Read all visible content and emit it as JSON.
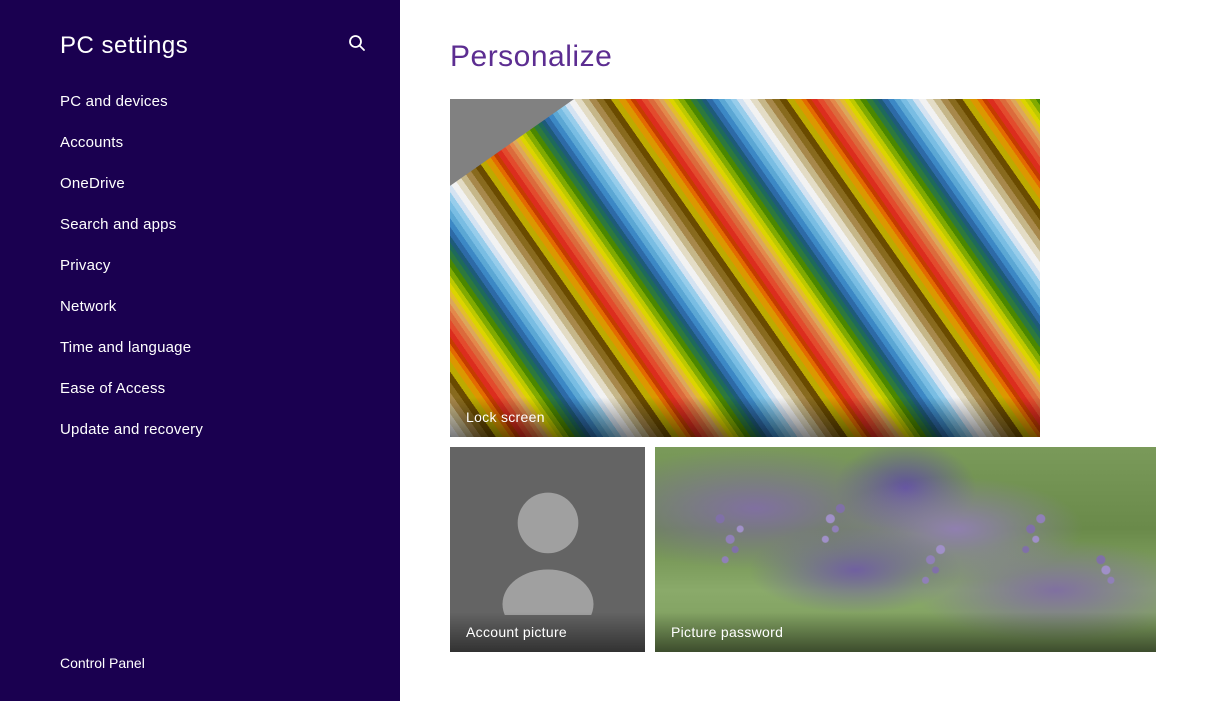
{
  "sidebar": {
    "title": "PC settings",
    "search_icon": "🔍",
    "nav_items": [
      {
        "id": "pc-and-devices",
        "label": "PC and devices",
        "active": false
      },
      {
        "id": "accounts",
        "label": "Accounts",
        "active": false
      },
      {
        "id": "onedrive",
        "label": "OneDrive",
        "active": false
      },
      {
        "id": "search-and-apps",
        "label": "Search and apps",
        "active": false
      },
      {
        "id": "privacy",
        "label": "Privacy",
        "active": false
      },
      {
        "id": "network",
        "label": "Network",
        "active": false
      },
      {
        "id": "time-and-language",
        "label": "Time and language",
        "active": false
      },
      {
        "id": "ease-of-access",
        "label": "Ease of Access",
        "active": false
      },
      {
        "id": "update-and-recovery",
        "label": "Update and recovery",
        "active": false
      }
    ],
    "footer": "Control Panel"
  },
  "main": {
    "title": "Personalize",
    "tiles": [
      {
        "id": "lock-screen",
        "label": "Lock screen"
      },
      {
        "id": "account-picture",
        "label": "Account picture"
      },
      {
        "id": "picture-password",
        "label": "Picture password"
      }
    ]
  }
}
